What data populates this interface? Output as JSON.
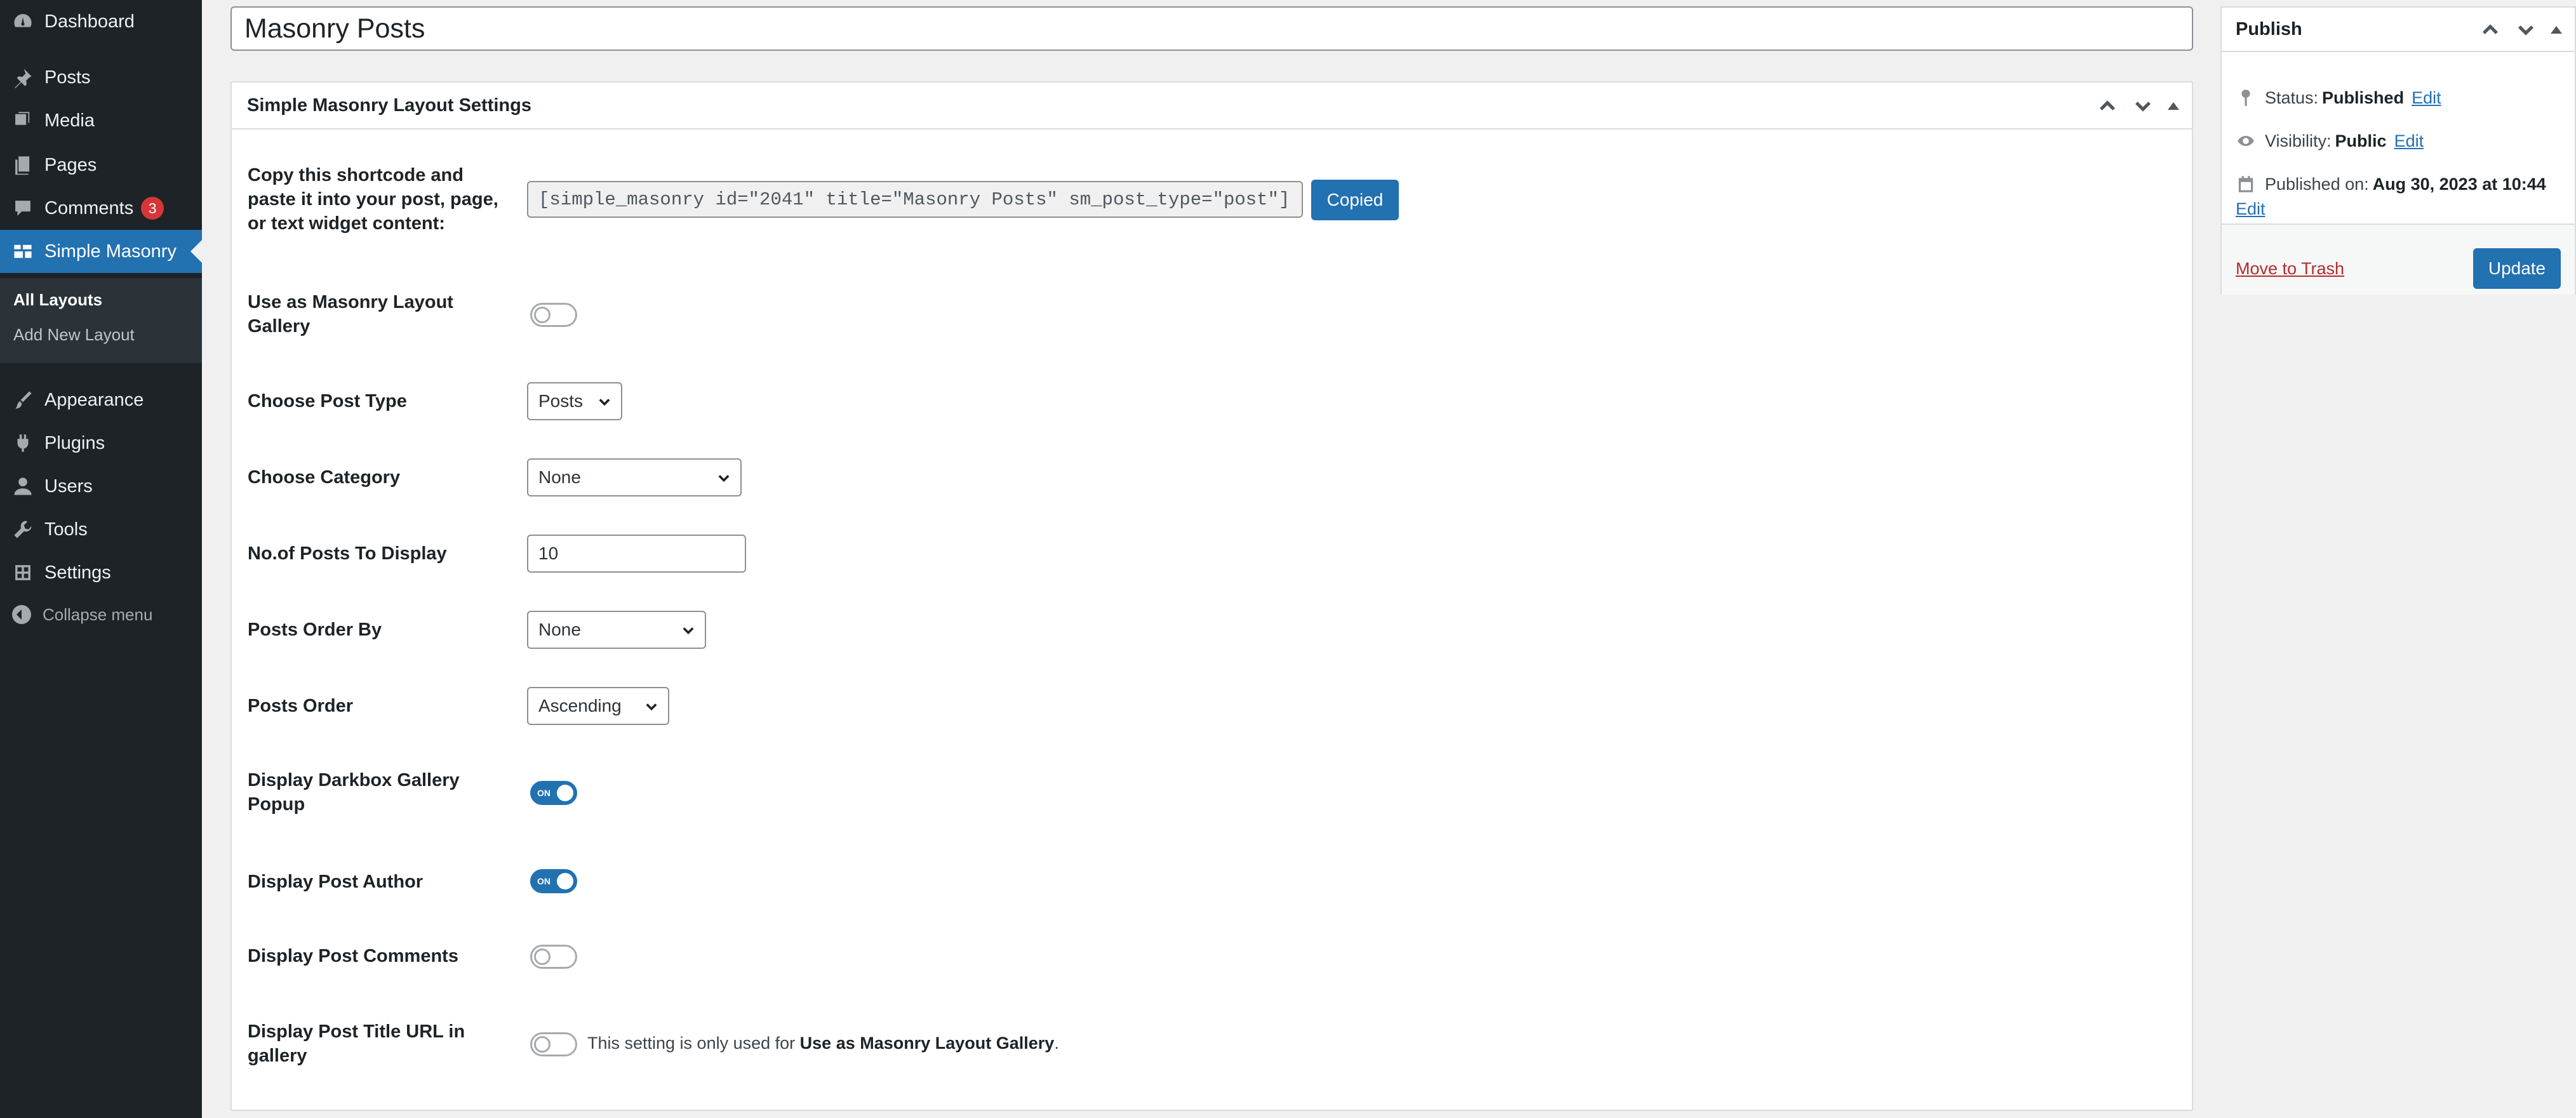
{
  "sidebar": {
    "items": [
      {
        "label": "Dashboard",
        "icon": "dashboard-icon"
      },
      {
        "label": "Posts",
        "icon": "pin-icon"
      },
      {
        "label": "Media",
        "icon": "media-icon"
      },
      {
        "label": "Pages",
        "icon": "pages-icon"
      },
      {
        "label": "Comments",
        "icon": "comment-icon",
        "badge": "3"
      },
      {
        "label": "Simple Masonry",
        "icon": "grid-icon",
        "current": true
      },
      {
        "label": "Appearance",
        "icon": "brush-icon"
      },
      {
        "label": "Plugins",
        "icon": "plugin-icon"
      },
      {
        "label": "Users",
        "icon": "user-icon"
      },
      {
        "label": "Tools",
        "icon": "wrench-icon"
      },
      {
        "label": "Settings",
        "icon": "settings-icon"
      }
    ],
    "submenu": [
      "All Layouts",
      "Add New Layout"
    ],
    "collapse_label": "Collapse menu"
  },
  "post": {
    "title": "Masonry Posts"
  },
  "settings_box": {
    "title": "Simple Masonry Layout Settings",
    "shortcode_label": "Copy this shortcode and paste it into your post, page, or text widget content:",
    "shortcode_value": "[simple_masonry id=\"2041\" title=\"Masonry Posts\" sm_post_type=\"post\"]",
    "copied_button": "Copied",
    "gallery_label": "Use as Masonry Layout Gallery",
    "gallery_on": false,
    "post_type_label": "Choose Post Type",
    "post_type_value": "Posts",
    "category_label": "Choose Category",
    "category_value": "None",
    "num_posts_label": "No.of Posts To Display",
    "num_posts_value": "10",
    "order_by_label": "Posts Order By",
    "order_by_value": "None",
    "order_label": "Posts Order",
    "order_value": "Ascending",
    "darkbox_label": "Display Darkbox Gallery Popup",
    "darkbox_on": true,
    "author_label": "Display Post Author",
    "author_on": true,
    "comments_label": "Display Post Comments",
    "comments_on": false,
    "title_url_label": "Display Post Title URL in gallery",
    "title_url_on": false,
    "toggle_on_text": "ON",
    "title_url_note_prefix": "This setting is only used for ",
    "title_url_note_bold": "Use as Masonry Layout Gallery",
    "title_url_note_suffix": "."
  },
  "publish": {
    "title": "Publish",
    "status_label": "Status:",
    "status_value": "Published",
    "visibility_label": "Visibility:",
    "visibility_value": "Public",
    "published_label": "Published on:",
    "published_value": "Aug 30, 2023 at 10:44",
    "edit_link": "Edit",
    "trash_link": "Move to Trash",
    "update_button": "Update"
  },
  "colors": {
    "sidebar_bg": "#1d2327",
    "accent": "#2271b1",
    "badge": "#d63638",
    "trash": "#b32d2e"
  }
}
